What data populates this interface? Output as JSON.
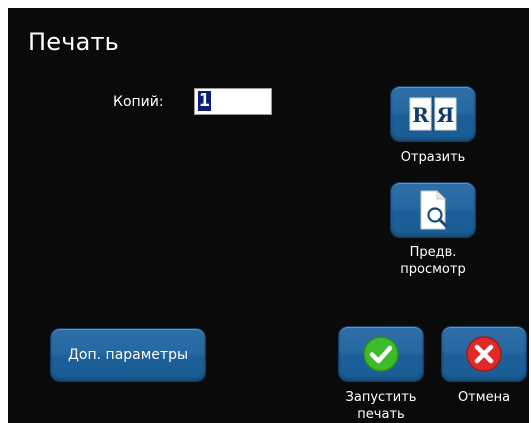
{
  "dialog": {
    "title": "Печать"
  },
  "copies": {
    "label": "Копий:",
    "value": "1"
  },
  "buttons": {
    "mirror": {
      "label": "Отразить",
      "icon": "mirror-r-ya-icon"
    },
    "preview": {
      "label_line1": "Предв.",
      "label_line2": "просмотр",
      "icon": "document-magnifier-icon"
    },
    "more_options": {
      "label": "Доп. параметры"
    },
    "start_print": {
      "label_line1": "Запустить",
      "label_line2": "печать",
      "icon": "green-check-icon"
    },
    "cancel": {
      "label": "Отмена",
      "icon": "red-x-icon"
    }
  },
  "colors": {
    "background": "#0a0a0a",
    "button_blue": "#2569a2",
    "check_green": "#3dbb2a",
    "cancel_red": "#e02a2a"
  }
}
